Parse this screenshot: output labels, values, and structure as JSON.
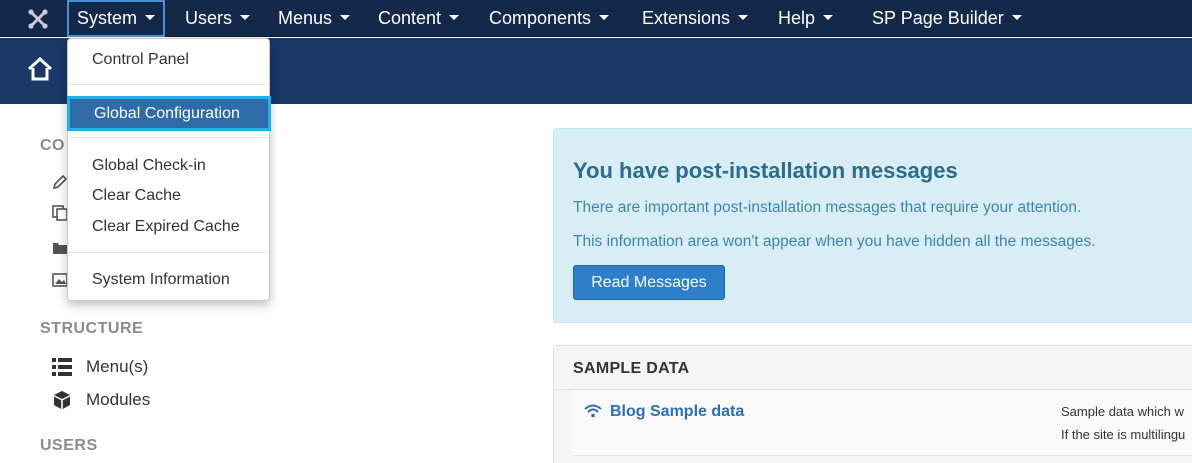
{
  "navbar": {
    "logo_icon": "joomla-logo-icon",
    "menus": [
      {
        "label": "System"
      },
      {
        "label": "Users"
      },
      {
        "label": "Menus"
      },
      {
        "label": "Content"
      },
      {
        "label": "Components"
      },
      {
        "label": "Extensions"
      },
      {
        "label": "Help"
      },
      {
        "label": "SP Page Builder"
      }
    ]
  },
  "header": {
    "home_icon": "home-icon"
  },
  "dropdown": {
    "items": [
      {
        "label": "Control Panel"
      },
      {
        "label": "Global Configuration"
      },
      {
        "label": "Global Check-in"
      },
      {
        "label": "Clear Cache"
      },
      {
        "label": "Clear Expired Cache"
      },
      {
        "label": "System Information"
      }
    ],
    "selected": "Global Configuration"
  },
  "sidebar": {
    "partial_heading": "CO",
    "structure_heading": "STRUCTURE",
    "structure_items": [
      {
        "label": "Menu(s)",
        "icon": "list-icon"
      },
      {
        "label": "Modules",
        "icon": "cube-icon"
      }
    ],
    "users_heading": "USERS"
  },
  "messages": {
    "title": "You have post-installation messages",
    "line1": "There are important post-installation messages that require your attention.",
    "line2": "This information area won't appear when you have hidden all the messages.",
    "button": "Read Messages"
  },
  "sample_data": {
    "heading": "SAMPLE DATA",
    "item": {
      "label": "Blog Sample data",
      "icon": "wifi-icon",
      "desc1": "Sample data which w",
      "desc2": "If the site is multilingu"
    }
  },
  "colors": {
    "navbar": "#142849",
    "header": "#1a3867",
    "selected_item": "#2f6aa9",
    "selected_border": "#1fb3ec",
    "info_panel": "#d9edf7",
    "button": "#2d7fc9"
  }
}
